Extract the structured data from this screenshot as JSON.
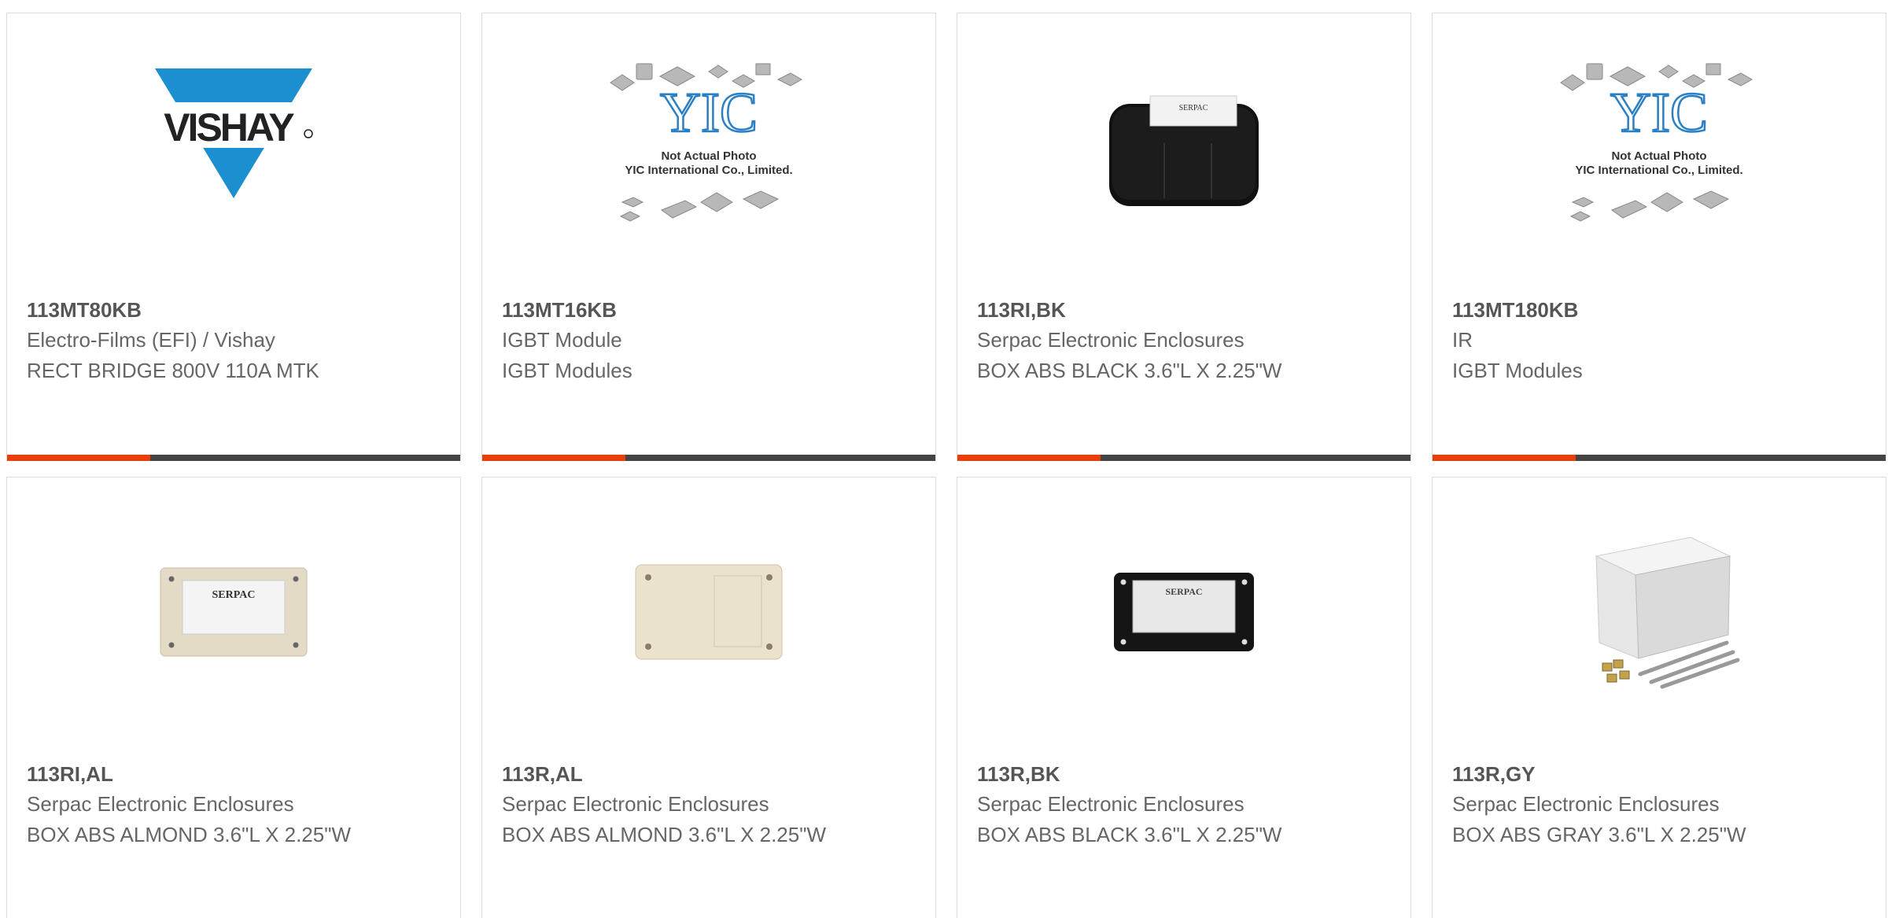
{
  "colors": {
    "accent": "#e8400c",
    "bar": "#444444",
    "border": "#dcdcdc",
    "vishay_blue": "#1b8fd0",
    "yic_blue": "#2b7fc4"
  },
  "products": [
    {
      "part_number": "113MT80KB",
      "manufacturer": "Electro-Films (EFI) / Vishay",
      "description": "RECT BRIDGE 800V 110A MTK",
      "image": "vishay-logo",
      "logo_text": "VISHAY"
    },
    {
      "part_number": "113MT16KB",
      "manufacturer": "IGBT Module",
      "description": "IGBT Modules",
      "image": "yic-placeholder",
      "placeholder_line1": "Not Actual Photo",
      "placeholder_line2": "YIC International Co., Limited."
    },
    {
      "part_number": "113RI,BK",
      "manufacturer": "Serpac Electronic Enclosures",
      "description": "BOX ABS BLACK 3.6\"L X 2.25\"W",
      "image": "black-box",
      "label_text": "SERPAC"
    },
    {
      "part_number": "113MT180KB",
      "manufacturer": "IR",
      "description": "IGBT Modules",
      "image": "yic-placeholder",
      "placeholder_line1": "Not Actual Photo",
      "placeholder_line2": "YIC International Co., Limited."
    },
    {
      "part_number": "113RI,AL",
      "manufacturer": "Serpac Electronic Enclosures",
      "description": "BOX ABS ALMOND 3.6\"L X 2.25\"W",
      "image": "almond-labeled-box",
      "label_text": "SERPAC"
    },
    {
      "part_number": "113R,AL",
      "manufacturer": "Serpac Electronic Enclosures",
      "description": "BOX ABS ALMOND 3.6\"L X 2.25\"W",
      "image": "almond-plain-box"
    },
    {
      "part_number": "113R,BK",
      "manufacturer": "Serpac Electronic Enclosures",
      "description": "BOX ABS BLACK 3.6\"L X 2.25\"W",
      "image": "black-flat-box",
      "label_text": "SERPAC"
    },
    {
      "part_number": "113R,GY",
      "manufacturer": "Serpac Electronic Enclosures",
      "description": "BOX ABS GRAY 3.6\"L X 2.25\"W",
      "image": "gray-box-screws"
    }
  ]
}
